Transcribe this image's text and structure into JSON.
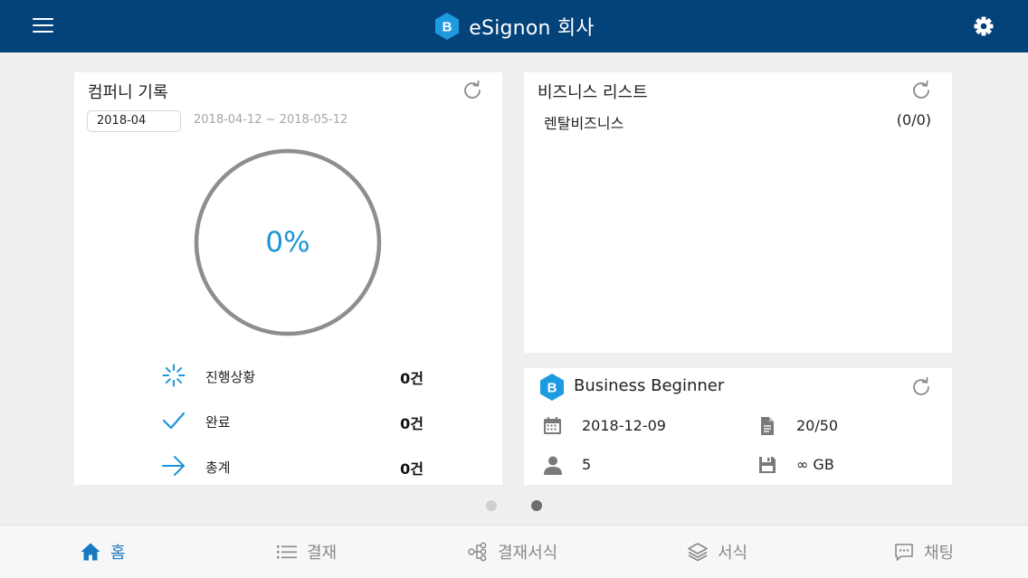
{
  "app": {
    "title": "eSignon 회사",
    "logo_letter": "B"
  },
  "colors": {
    "header_bg": "#04427a",
    "accent": "#1b95d9",
    "ring": "#8e8e8e",
    "logo": "#1e9be0"
  },
  "company_card": {
    "title": "컴퍼니 기록",
    "month": "2018-04",
    "range": "2018-04-12 ~ 2018-05-12",
    "progress_percent": 0,
    "progress_label": "0%",
    "stats": [
      {
        "icon": "loading-spinner-icon",
        "label": "진행상황",
        "count": "0건"
      },
      {
        "icon": "checkmark-icon",
        "label": "완료",
        "count": "0건"
      },
      {
        "icon": "arrow-right-icon",
        "label": "총계",
        "count": "0건"
      }
    ]
  },
  "business_card": {
    "title": "비즈니스 리스트",
    "items": [
      {
        "name": "렌탈비즈니스",
        "count": "(0/0)"
      }
    ]
  },
  "plan_card": {
    "title": "Business Beginner",
    "logo_letter": "B",
    "expiry_date": "2018-12-09",
    "documents": "20/50",
    "users": "5",
    "storage": "∞ GB"
  },
  "pager": {
    "pages": 2,
    "active_index": 1
  },
  "bottom_nav": [
    {
      "icon": "home-icon",
      "label": "홈",
      "active": true
    },
    {
      "icon": "list-icon",
      "label": "결재",
      "active": false
    },
    {
      "icon": "flow-chart-icon",
      "label": "결재서식",
      "active": false
    },
    {
      "icon": "layers-icon",
      "label": "서식",
      "active": false
    },
    {
      "icon": "chat-bubble-icon",
      "label": "채팅",
      "active": false
    }
  ]
}
